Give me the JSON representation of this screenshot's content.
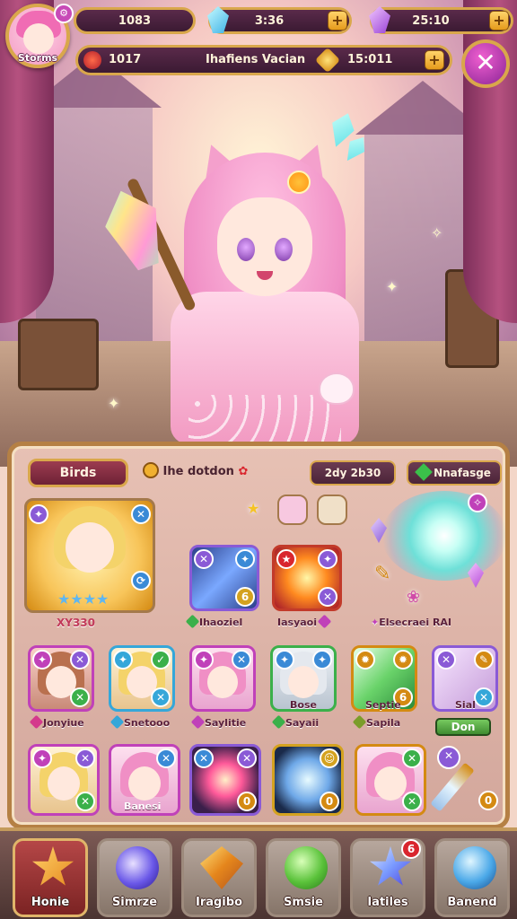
{
  "player": {
    "name": "Storms"
  },
  "resources": [
    {
      "value": "1083",
      "plus": "+"
    },
    {
      "value": "3:36",
      "plus": "+"
    },
    {
      "value": "25:10",
      "plus": "+"
    }
  ],
  "quest_bar": {
    "left": "1017",
    "title": "Ihafiens Vacian",
    "right": "15:011",
    "plus": "+"
  },
  "close_icon": "close-icon",
  "panel": {
    "tab": "Birds",
    "info": "Ihe dotdon",
    "timer": "2dy 2b30",
    "nav_btn": "Nnafasge",
    "featured_label": "XY330",
    "skill1_label": "Ihaoziel",
    "skill2_label": "Iasyaoi",
    "portal_label": "Elsecraei RAI",
    "row1": [
      {
        "label": "Jonyiue",
        "icon_color": "#d43a8c"
      },
      {
        "label": "Snetooo",
        "icon_color": "#35a7d9"
      },
      {
        "label": "Saylitie",
        "icon_color": "#c041b9"
      },
      {
        "label": "Sayaii",
        "icon_color": "#3bb04a"
      },
      {
        "label": "Sapila",
        "icon_color": "#7b9d2a"
      },
      {
        "label": "Sial"
      }
    ],
    "row1_top_labels": {
      "card4": "Bose",
      "card5": "Septie"
    },
    "row2_label": "Banesi",
    "green_button": "Don",
    "counters": [
      "0",
      "0",
      "0"
    ]
  },
  "nav": [
    {
      "label": "Honie",
      "icon": "home-star-icon",
      "active": true
    },
    {
      "label": "Simrze",
      "icon": "swirl-orb-icon"
    },
    {
      "label": "Iragibo",
      "icon": "amber-gem-icon"
    },
    {
      "label": "Smsie",
      "icon": "green-orb-icon"
    },
    {
      "label": "Iatiles",
      "icon": "blue-star-icon",
      "badge": "6"
    },
    {
      "label": "Banend",
      "icon": "blue-globe-icon"
    }
  ],
  "colors": {
    "gold": "#d9a74b",
    "plum": "#5a2a4a",
    "panel": "#e7c1b4",
    "pink": "#f29ac2"
  }
}
